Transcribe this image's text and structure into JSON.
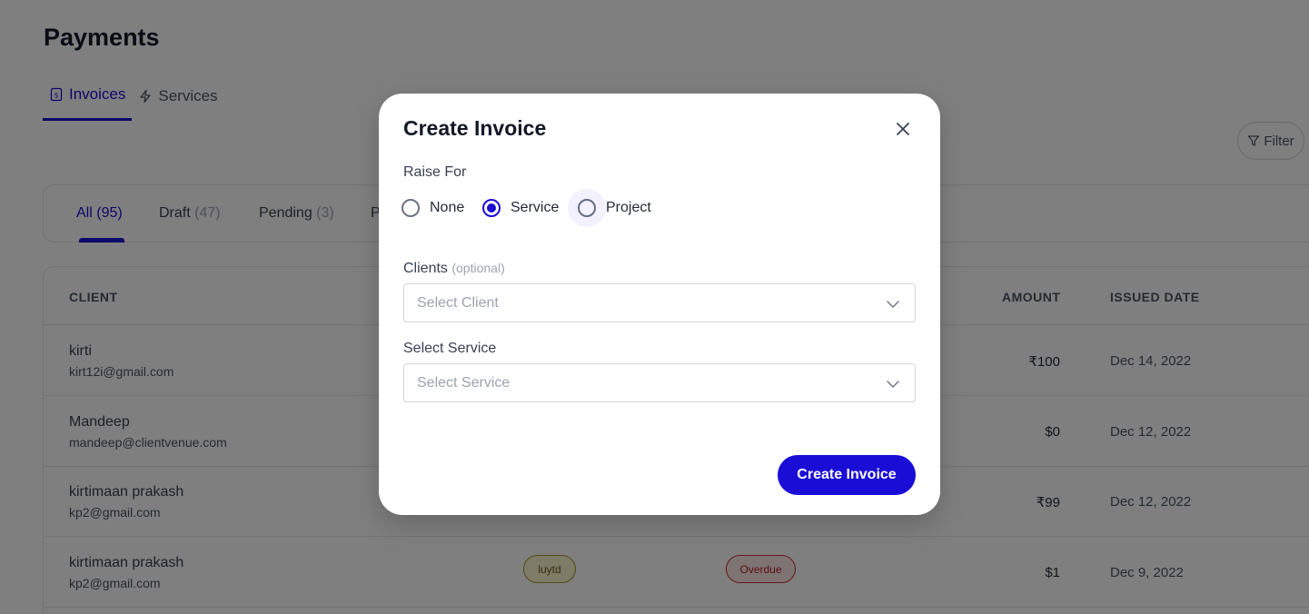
{
  "page": {
    "title": "Payments",
    "tabs": [
      {
        "label": "Invoices",
        "icon": "invoice-icon",
        "active": true
      },
      {
        "label": "Services",
        "icon": "bolt-icon",
        "active": false
      }
    ],
    "filter_label": "Filter",
    "status_tabs": [
      {
        "label": "All",
        "count": "(95)",
        "active": true
      },
      {
        "label": "Draft",
        "count": "(47)",
        "active": false
      },
      {
        "label": "Pending",
        "count": "(3)",
        "active": false
      },
      {
        "label": "P",
        "count": "",
        "active": false
      }
    ],
    "table": {
      "headers": {
        "client": "CLIENT",
        "amount": "AMOUNT",
        "issued_date": "ISSUED DATE"
      },
      "rows": [
        {
          "name": "kirti",
          "email": "kirt12i@gmail.com",
          "amount": "₹100",
          "date": "Dec 14, 2022"
        },
        {
          "name": "Mandeep",
          "email": "mandeep@clientvenue.com",
          "amount": "$0",
          "date": "Dec 12, 2022"
        },
        {
          "name": "kirtimaan prakash",
          "email": "kp2@gmail.com",
          "amount": "₹99",
          "date": "Dec 12, 2022"
        },
        {
          "name": "kirtimaan prakash",
          "email": "kp2@gmail.com",
          "amount": "$1",
          "date": "Dec 9, 2022",
          "service": "luytd",
          "status": "Overdue"
        }
      ]
    }
  },
  "modal": {
    "title": "Create Invoice",
    "raise_for": {
      "label": "Raise For",
      "options": [
        "None",
        "Service",
        "Project"
      ],
      "selected": "Service"
    },
    "clients": {
      "label": "Clients",
      "optional": "(optional)",
      "placeholder": "Select Client"
    },
    "service": {
      "label": "Select Service",
      "placeholder": "Select Service"
    },
    "submit_label": "Create Invoice"
  },
  "colors": {
    "accent": "#1a0dd6",
    "overlay": "rgba(0,0,0,0.5)",
    "pill_service": "#fdf6cf",
    "pill_overdue": "#fde8e8"
  }
}
